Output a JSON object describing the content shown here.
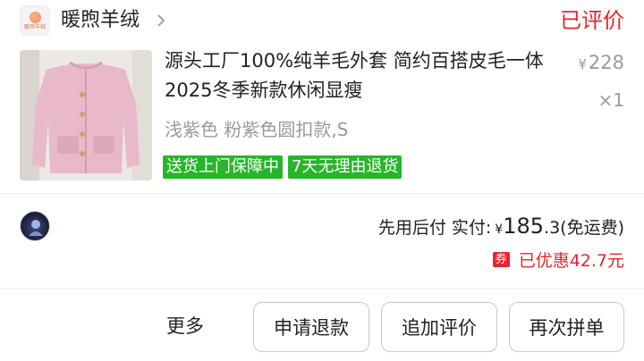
{
  "shop": {
    "logo_text": "暖煦羊绒",
    "name": "暖煦羊绒",
    "chevron_icon": "chevron-right-icon"
  },
  "order": {
    "status": "已评价"
  },
  "product": {
    "title": "源头工厂100%纯羊毛外套 简约百搭皮毛一体2025冬季新款休闲显瘦",
    "price_symbol": "¥",
    "price": "228",
    "quantity": "×1",
    "spec": "浅紫色 粉紫色圆扣款,S",
    "tags": [
      "送货上门保障中",
      "7天无理由退货"
    ],
    "tag_color": "#27b52a",
    "thumbnail": "pink-fur-coat-image"
  },
  "payment": {
    "label": "先用后付 实付:",
    "currency": "¥",
    "amount_int": "185",
    "amount_dec": ".3",
    "shipping_note": "(免运费)",
    "coupon_badge": "券",
    "discount_text": "已优惠42.7元",
    "accent_color": "#e5262c"
  },
  "buyer": {
    "avatar": "user-avatar"
  },
  "actions": {
    "more": "更多",
    "refund": "申请退款",
    "add_review": "追加评价",
    "rebuy": "再次拼单"
  }
}
